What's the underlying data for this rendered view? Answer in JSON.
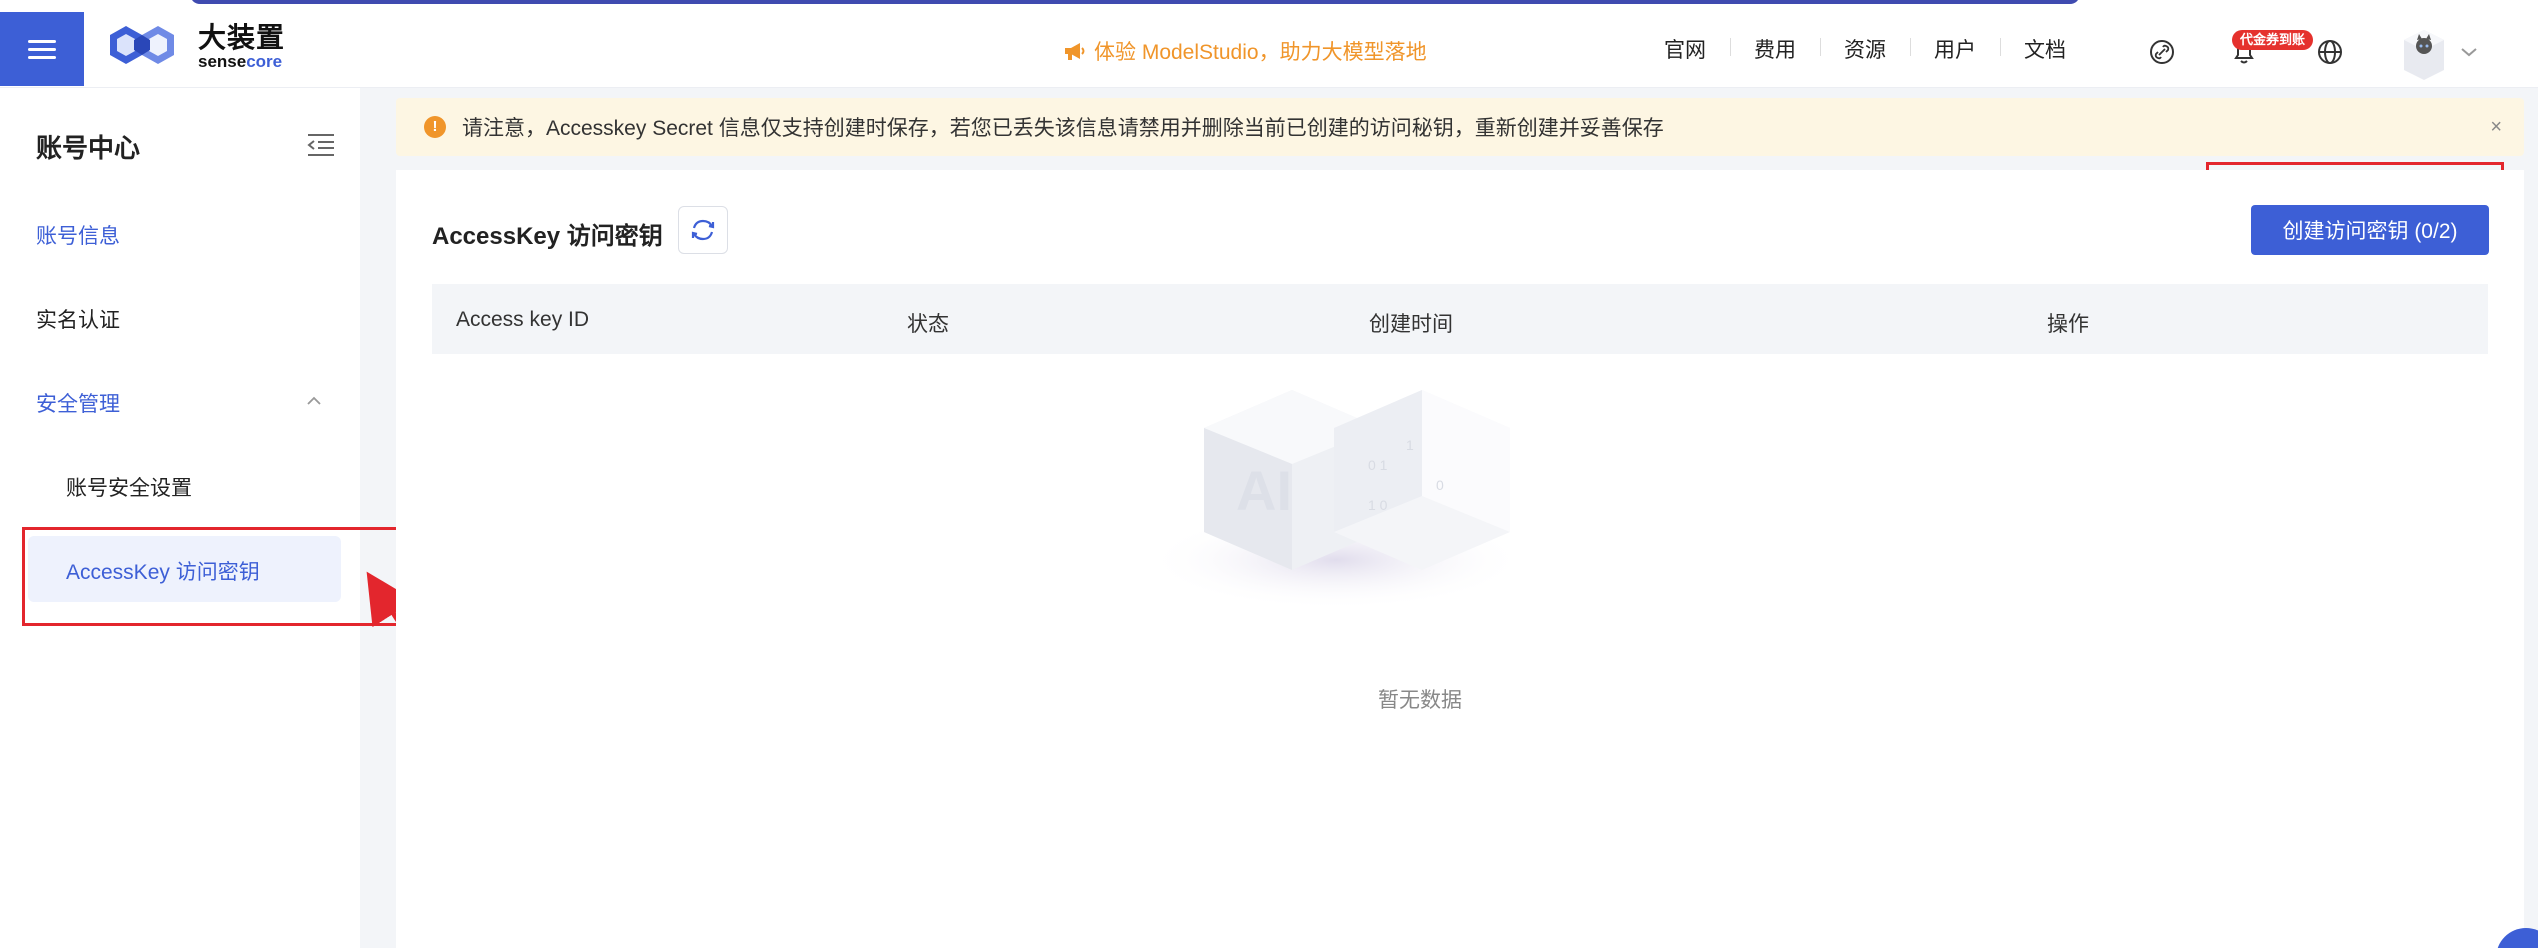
{
  "header": {
    "logo_cn": "大装置",
    "logo_en_a": "sense",
    "logo_en_b": "core",
    "promo": "体验 ModelStudio，助力大模型落地",
    "nav": [
      "官网",
      "费用",
      "资源",
      "用户",
      "文档"
    ],
    "badge": "代金券到账",
    "icons": [
      "menu-icon",
      "megaphone-icon",
      "link-icon",
      "bell-icon",
      "globe-icon",
      "avatar",
      "chevron-down-icon"
    ]
  },
  "sidebar": {
    "title": "账号中心",
    "items": [
      {
        "label": "账号信息"
      },
      {
        "label": "实名认证"
      },
      {
        "label": "安全管理"
      },
      {
        "label": "账号安全设置"
      },
      {
        "label": "AccessKey 访问密钥"
      }
    ]
  },
  "alert": {
    "message": "请注意，Accesskey Secret 信息仅支持创建时保存，若您已丢失该信息请禁用并删除当前已创建的访问秘钥，重新创建并妥善保存",
    "close": "×",
    "icon": "!"
  },
  "main": {
    "title": "AccessKey 访问密钥",
    "create_button": "创建访问密钥 (0/2)",
    "columns": [
      "Access key ID",
      "状态",
      "创建时间",
      "操作"
    ],
    "empty_text": "暂无数据"
  },
  "colors": {
    "accent": "#3d5fd6",
    "promo": "#f0952a",
    "alert_bg": "#fdf6e3",
    "annotation": "#e3262d"
  }
}
